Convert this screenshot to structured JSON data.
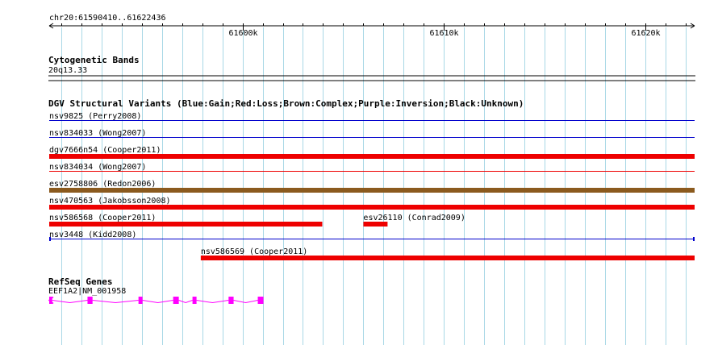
{
  "ruler": {
    "location": "chr20:61590410..61622436",
    "ticks": [
      {
        "pos": 61600000,
        "label": "61600k"
      },
      {
        "pos": 61610000,
        "label": "61610k"
      },
      {
        "pos": 61620000,
        "label": "61620k"
      }
    ]
  },
  "view": {
    "start": 61590410,
    "end": 61622436
  },
  "cytoband": {
    "title": "Cytogenetic Bands",
    "band": "20q13.33"
  },
  "dgv": {
    "title": "DGV Structural Variants (Blue:Gain;Red:Loss;Brown:Complex;Purple:Inversion;Black:Unknown)",
    "colors": {
      "gain": "#0000cc",
      "loss": "#ee0000",
      "complex": "#8b5a1e"
    },
    "features": [
      {
        "label": "nsv9825 (Perry2008)",
        "type": "gain",
        "style": "thin",
        "start": 61590410,
        "end": 61622436
      },
      {
        "label": "nsv834033 (Wong2007)",
        "type": "gain",
        "style": "thin",
        "start": 61590410,
        "end": 61622436
      },
      {
        "label": "dgv7666n54 (Cooper2011)",
        "type": "loss",
        "style": "thick",
        "start": 61590410,
        "end": 61622436
      },
      {
        "label": "nsv834034 (Wong2007)",
        "type": "loss",
        "style": "thin",
        "start": 61590410,
        "end": 61622436
      },
      {
        "label": "esv2758806 (Redon2006)",
        "type": "complex",
        "style": "thick",
        "start": 61590410,
        "end": 61622436
      },
      {
        "label": "nsv470563 (Jakobsson2008)",
        "type": "loss",
        "style": "thick",
        "start": 61590410,
        "end": 61622436
      },
      {
        "label": "nsv586568 (Cooper2011)",
        "type": "loss",
        "style": "thick",
        "start": 61590410,
        "end": 61603960
      },
      {
        "label": "esv26110 (Conrad2009)",
        "type": "loss",
        "style": "thick",
        "start": 61606000,
        "end": 61607200
      },
      {
        "label": "nsv3448 (Kidd2008)",
        "type": "gain",
        "style": "capped",
        "start": 61590410,
        "end": 61622436
      },
      {
        "label": "nsv586569 (Cooper2011)",
        "type": "loss",
        "style": "thick",
        "start": 61597930,
        "end": 61622436
      }
    ]
  },
  "refseq": {
    "title": "RefSeq Genes",
    "color": "#ff00ff",
    "genes": [
      {
        "label": "EEF1A2|NM_001958",
        "strand": "-",
        "start": 61590410,
        "end": 61601040,
        "exons": [
          [
            61590410,
            61590560
          ],
          [
            61592310,
            61592560
          ],
          [
            61594840,
            61595040
          ],
          [
            61596560,
            61596840
          ],
          [
            61597520,
            61597720
          ],
          [
            61599310,
            61599560
          ],
          [
            61600760,
            61601040
          ]
        ]
      }
    ]
  }
}
